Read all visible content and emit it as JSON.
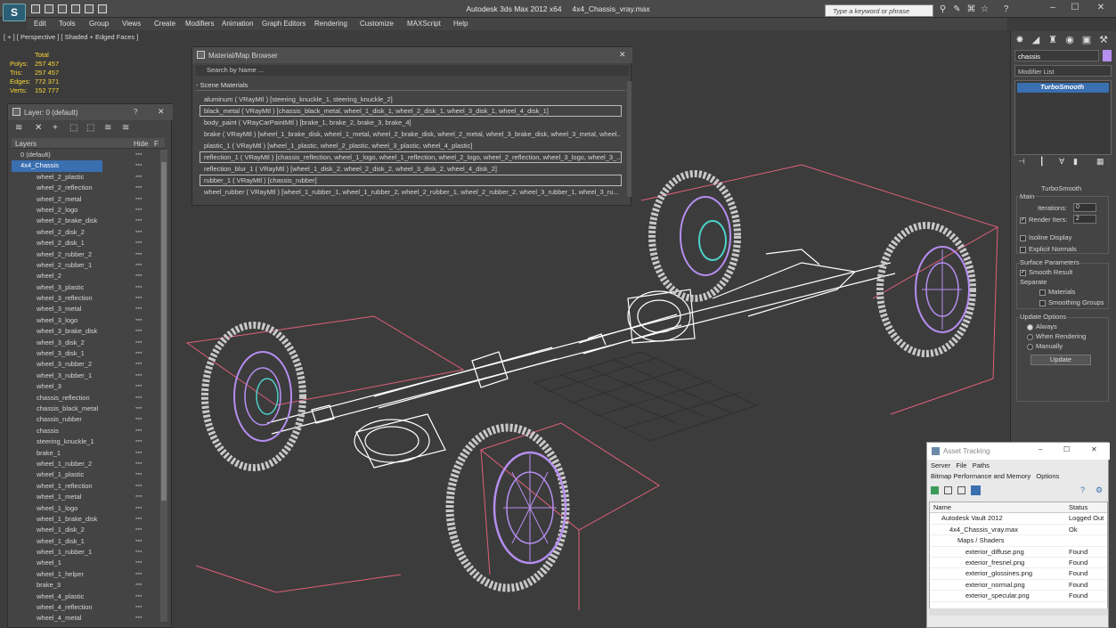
{
  "app": {
    "title_left": "Autodesk 3ds Max  2012 x64",
    "title_right": "4x4_Chassis_vray.max",
    "logo_label": "S",
    "search_placeholder": "Type a keyword or phrase"
  },
  "menu": [
    "Edit",
    "Tools",
    "Group",
    "Views",
    "Create",
    "Modifiers",
    "Animation",
    "Graph Editors",
    "Rendering",
    "Customize",
    "MAXScript",
    "Help"
  ],
  "viewport": {
    "label": "[ + ] [ Perspective ] [ Shaded + Edged Faces ]",
    "stats": {
      "header": "Total",
      "rows": [
        {
          "label": "Polys:",
          "value": "257 457"
        },
        {
          "label": "Tris:",
          "value": "257 457"
        },
        {
          "label": "Edges:",
          "value": "772 371"
        },
        {
          "label": "Verts:",
          "value": "152 777"
        }
      ]
    }
  },
  "layer_panel": {
    "title": "Layer: 0 (default)",
    "help": "?",
    "close": "✕",
    "col_layers": "Layers",
    "col_hide": "Hide",
    "col_f": "F",
    "rows": [
      {
        "name": "0 (default)",
        "type": "layer"
      },
      {
        "name": "4x4_Chassis",
        "type": "layer-selected"
      },
      {
        "name": "wheel_2_plastic"
      },
      {
        "name": "wheel_2_reflection"
      },
      {
        "name": "wheel_2_metal"
      },
      {
        "name": "wheel_2_logo"
      },
      {
        "name": "wheel_2_brake_disk"
      },
      {
        "name": "wheel_2_disk_2"
      },
      {
        "name": "wheel_2_disk_1"
      },
      {
        "name": "wheel_2_rubber_2"
      },
      {
        "name": "wheel_2_rubber_1"
      },
      {
        "name": "wheel_2"
      },
      {
        "name": "wheel_3_plastic"
      },
      {
        "name": "wheel_3_reflection"
      },
      {
        "name": "wheel_3_metal"
      },
      {
        "name": "wheel_3_logo"
      },
      {
        "name": "wheel_3_brake_disk"
      },
      {
        "name": "wheel_3_disk_2"
      },
      {
        "name": "wheel_3_disk_1"
      },
      {
        "name": "wheel_3_rubber_2"
      },
      {
        "name": "wheel_3_rubber_1"
      },
      {
        "name": "wheel_3"
      },
      {
        "name": "chassis_reflection"
      },
      {
        "name": "chassis_black_metal"
      },
      {
        "name": "chassis_rubber"
      },
      {
        "name": "chassis"
      },
      {
        "name": "steering_knuckle_1"
      },
      {
        "name": "brake_1"
      },
      {
        "name": "wheel_1_rubber_2"
      },
      {
        "name": "wheel_1_plastic"
      },
      {
        "name": "wheel_1_reflection"
      },
      {
        "name": "wheel_1_metal"
      },
      {
        "name": "wheel_1_logo"
      },
      {
        "name": "wheel_1_brake_disk"
      },
      {
        "name": "wheel_1_disk_2"
      },
      {
        "name": "wheel_1_disk_1"
      },
      {
        "name": "wheel_1_rubber_1"
      },
      {
        "name": "wheel_1"
      },
      {
        "name": "wheel_1_helper"
      },
      {
        "name": "brake_3"
      },
      {
        "name": "wheel_4_plastic"
      },
      {
        "name": "wheel_4_reflection"
      },
      {
        "name": "wheel_4_metal"
      }
    ]
  },
  "material_browser": {
    "title": "Material/Map Browser",
    "close": "✕",
    "search_placeholder": "Search by Name ...",
    "section": "- Scene Materials",
    "rows": [
      {
        "text": "aluminum  ( VRayMtl )  [steering_knuckle_1, steering_knuckle_2]",
        "boxed": false
      },
      {
        "text": "black_metal  ( VRayMtl )  [chassis_black_metal, wheel_1_disk_1, wheel_2_disk_1, wheel_3_disk_1, wheel_4_disk_1]",
        "boxed": true
      },
      {
        "text": "body_paint  ( VRayCarPaintMtl )  [brake_1, brake_2, brake_3, brake_4]",
        "boxed": false
      },
      {
        "text": "brake  ( VRayMtl )  [wheel_1_brake_disk, wheel_1_metal, wheel_2_brake_disk, wheel_2_metal, wheel_3_brake_disk, wheel_3_metal, wheel...",
        "boxed": false
      },
      {
        "text": "plastic_1  ( VRayMtl )  [wheel_1_plastic, wheel_2_plastic, wheel_3_plastic, wheel_4_plastic]",
        "boxed": false
      },
      {
        "text": "reflection_1  ( VRayMtl )  [chassis_reflection, wheel_1_logo, wheel_1_reflection, wheel_2_logo, wheel_2_reflection, wheel_3_logo, wheel_3_...",
        "boxed": true
      },
      {
        "text": "reflection_blur_1  ( VRayMtl )  [wheel_1_disk_2, wheel_2_disk_2, wheel_3_disk_2, wheel_4_disk_2]",
        "boxed": false
      },
      {
        "text": "rubber_1  ( VRayMtl )  [chassis_rubber]",
        "boxed": true
      },
      {
        "text": "wheel_rubber  ( VRayMtl )  [wheel_1_rubber_1, wheel_1_rubber_2, wheel_2_rubber_1, wheel_2_rubber_2, wheel_3_rubber_1, wheel_3_ru...",
        "boxed": false
      }
    ]
  },
  "command_panel": {
    "object_name": "chassis",
    "object_color": "#b78ff0",
    "modifier_list": "Modifier List",
    "stack_item": "TurboSmooth",
    "rollout_title": "TurboSmooth",
    "main_label": "Main",
    "iterations_label": "Iterations:",
    "iterations_value": "0",
    "render_iters_label": "Render Iters:",
    "render_iters_value": "2",
    "isoline_display": "Isoline Display",
    "explicit_normals": "Explicit Normals",
    "surface_params": "Surface Parameters",
    "smooth_result": "Smooth Result",
    "separate": "Separate",
    "materials": "Materials",
    "smoothing_groups": "Smoothing Groups",
    "update_options": "Update Options",
    "always": "Always",
    "when_rendering": "When Rendering",
    "manually": "Manually",
    "update_button": "Update"
  },
  "asset_tracking": {
    "title": "Asset Tracking",
    "menu1": [
      "Server",
      "File",
      "Paths"
    ],
    "menu2": [
      "Bitmap Performance and Memory",
      "Options"
    ],
    "col_name": "Name",
    "col_status": "Status",
    "rows": [
      {
        "name": "Autodesk Vault 2012",
        "status": "Logged Out",
        "indent": 1
      },
      {
        "name": "4x4_Chassis_vray.max",
        "status": "Ok",
        "indent": 2
      },
      {
        "name": "Maps / Shaders",
        "status": "",
        "indent": 3
      },
      {
        "name": "exterior_diffuse.png",
        "status": "Found",
        "indent": 4
      },
      {
        "name": "exterior_fresnel.png",
        "status": "Found",
        "indent": 4
      },
      {
        "name": "exterior_glossines.png",
        "status": "Found",
        "indent": 4
      },
      {
        "name": "exterior_normal.png",
        "status": "Found",
        "indent": 4
      },
      {
        "name": "exterior_specular.png",
        "status": "Found",
        "indent": 4
      }
    ]
  },
  "colors": {
    "wire": "#ffffff",
    "tire": "#c8c8c8",
    "rim": "#b58ef0",
    "bbox": "#e0607a",
    "selection": "#3a6fb0"
  }
}
